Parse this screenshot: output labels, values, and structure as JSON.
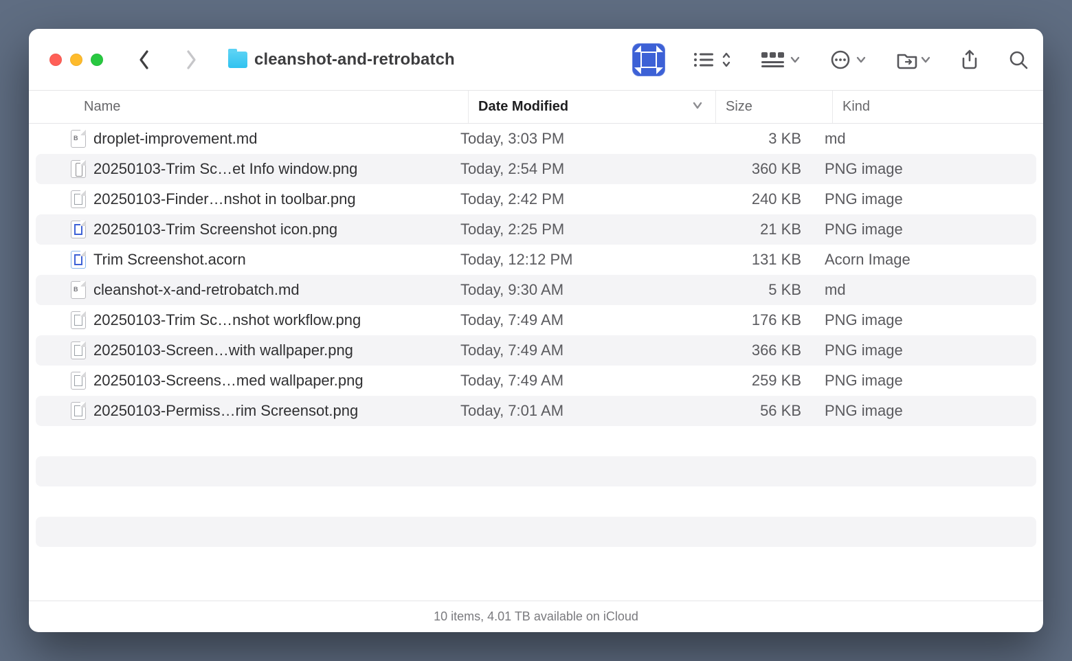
{
  "window": {
    "title": "cleanshot-and-retrobatch"
  },
  "columns": {
    "name": "Name",
    "date": "Date Modified",
    "size": "Size",
    "kind": "Kind",
    "sorted_by": "date",
    "sort_direction": "desc"
  },
  "files": [
    {
      "icon": "md",
      "name": "droplet-improvement.md",
      "date": "Today, 3:03 PM",
      "size": "3 KB",
      "kind": "md"
    },
    {
      "icon": "info",
      "name": "20250103-Trim Sc…et Info window.png",
      "date": "Today, 2:54 PM",
      "size": "360 KB",
      "kind": "PNG image"
    },
    {
      "icon": "png",
      "name": "20250103-Finder…nshot in toolbar.png",
      "date": "Today, 2:42 PM",
      "size": "240 KB",
      "kind": "PNG image"
    },
    {
      "icon": "trim",
      "name": "20250103-Trim Screenshot icon.png",
      "date": "Today, 2:25 PM",
      "size": "21 KB",
      "kind": "PNG image"
    },
    {
      "icon": "acorn",
      "name": "Trim Screenshot.acorn",
      "date": "Today, 12:12 PM",
      "size": "131 KB",
      "kind": "Acorn Image"
    },
    {
      "icon": "md",
      "name": "cleanshot-x-and-retrobatch.md",
      "date": "Today, 9:30 AM",
      "size": "5 KB",
      "kind": "md"
    },
    {
      "icon": "png",
      "name": "20250103-Trim Sc…nshot workflow.png",
      "date": "Today, 7:49 AM",
      "size": "176 KB",
      "kind": "PNG image"
    },
    {
      "icon": "png",
      "name": "20250103-Screen…with wallpaper.png",
      "date": "Today, 7:49 AM",
      "size": "366 KB",
      "kind": "PNG image"
    },
    {
      "icon": "png",
      "name": "20250103-Screens…med wallpaper.png",
      "date": "Today, 7:49 AM",
      "size": "259 KB",
      "kind": "PNG image"
    },
    {
      "icon": "png",
      "name": "20250103-Permiss…rim Screensot.png",
      "date": "Today, 7:01 AM",
      "size": "56 KB",
      "kind": "PNG image"
    }
  ],
  "statusbar": {
    "text": "10 items, 4.01 TB available on iCloud"
  }
}
